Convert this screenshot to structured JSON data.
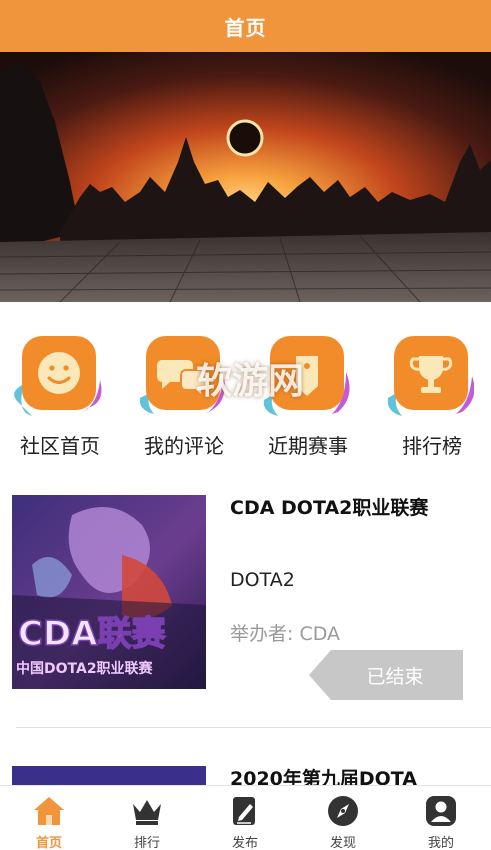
{
  "header": {
    "title": "首页"
  },
  "watermark": "软游网",
  "quick_nav": [
    {
      "label": "社区首页",
      "icon": "smiley-icon"
    },
    {
      "label": "我的评论",
      "icon": "chat-bubbles-icon"
    },
    {
      "label": "近期赛事",
      "icon": "tag-icon"
    },
    {
      "label": "排行榜",
      "icon": "trophy-icon"
    }
  ],
  "events": [
    {
      "name": "CDA DOTA2职业联赛",
      "game": "DOTA2",
      "organizer": "举办者: CDA",
      "status": "已结束",
      "thumb_text_big": "CDA联赛",
      "thumb_text_small": "中国DOTA2职业联赛"
    },
    {
      "name": "2020年第九届DOTA"
    }
  ],
  "tabbar": [
    {
      "label": "首页",
      "icon": "home-icon",
      "active": true
    },
    {
      "label": "排行",
      "icon": "crown-icon",
      "active": false
    },
    {
      "label": "发布",
      "icon": "edit-icon",
      "active": false
    },
    {
      "label": "发现",
      "icon": "compass-icon",
      "active": false
    },
    {
      "label": "我的",
      "icon": "user-icon",
      "active": false
    }
  ],
  "colors": {
    "accent": "#f0953c",
    "tile_orange": "#f28c2a",
    "status_gray": "#c7c7c7"
  }
}
